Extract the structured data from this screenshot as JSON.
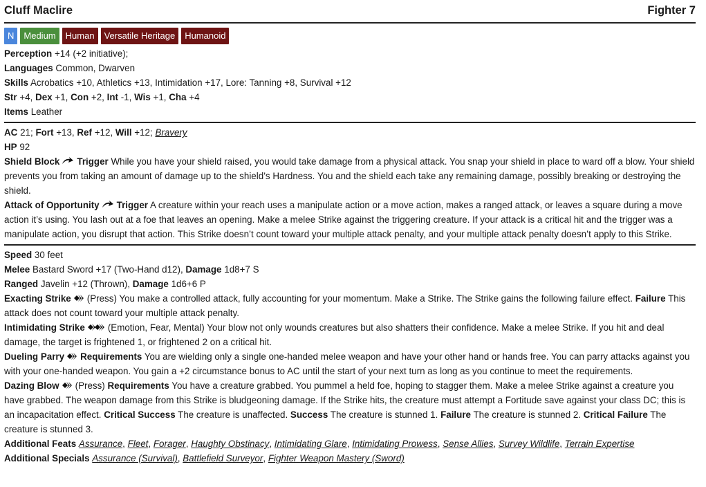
{
  "header": {
    "name": "Cluff Maclire",
    "class_level": "Fighter 7"
  },
  "traits": {
    "alignment": "N",
    "size": "Medium",
    "ancestry": [
      "Human",
      "Versatile Heritage",
      "Humanoid"
    ]
  },
  "colors": {
    "alignment": "#4a86dc",
    "size": "#4a8f3c",
    "ancestry": "#6e1414"
  },
  "perception": {
    "label": "Perception",
    "value": "+14 (+2 initiative);"
  },
  "languages": {
    "label": "Languages",
    "value": "Common, Dwarven"
  },
  "skills": {
    "label": "Skills",
    "value": "Acrobatics +10, Athletics +13, Intimidation +17, Lore: Tanning +8, Survival +12"
  },
  "attributes": [
    {
      "label": "Str",
      "value": "+4,"
    },
    {
      "label": "Dex",
      "value": "+1,"
    },
    {
      "label": "Con",
      "value": "+2,"
    },
    {
      "label": "Int",
      "value": "-1,"
    },
    {
      "label": "Wis",
      "value": "+1,"
    },
    {
      "label": "Cha",
      "value": "+4"
    }
  ],
  "items": {
    "label": "Items",
    "value": "Leather"
  },
  "defense": {
    "ac_label": "AC",
    "ac_value": "21;",
    "fort_label": "Fort",
    "fort_value": "+13,",
    "ref_label": "Ref",
    "ref_value": "+12,",
    "will_label": "Will",
    "will_value": "+12;",
    "will_link": "Bravery",
    "hp_label": "HP",
    "hp_value": "92"
  },
  "reactions": [
    {
      "name": "Shield Block",
      "trigger_label": "Trigger",
      "text": "While you have your shield raised, you would take damage from a physical attack. You snap your shield in place to ward off a blow. Your shield prevents you from taking an amount of damage up to the shield’s Hardness. You and the shield each take any remaining damage, possibly breaking or destroying the shield."
    },
    {
      "name": "Attack of Opportunity",
      "trigger_label": "Trigger",
      "text": "A creature within your reach uses a manipulate action or a move action, makes a ranged attack, or leaves a square during a move action it’s using. You lash out at a foe that leaves an opening. Make a melee Strike against the triggering creature. If your attack is a critical hit and the trigger was a manipulate action, you disrupt that action. This Strike doesn’t count toward your multiple attack penalty, and your multiple attack penalty doesn’t apply to this Strike."
    }
  ],
  "offense": {
    "speed_label": "Speed",
    "speed_value": "30 feet",
    "melee_label": "Melee",
    "melee_value": "Bastard Sword +17 (Two-Hand d12),",
    "melee_damage_label": "Damage",
    "melee_damage": "1d8+7 S",
    "ranged_label": "Ranged",
    "ranged_value": "Javelin +12 (Thrown),",
    "ranged_damage_label": "Damage",
    "ranged_damage": "1d6+6 P"
  },
  "actions": {
    "exacting": {
      "name": "Exacting Strike",
      "text": "(Press) You make a controlled attack, fully accounting for your momentum. Make a Strike. The Strike gains the following failure effect.",
      "failure_label": "Failure",
      "failure_text": "This attack does not count toward your multiple attack penalty."
    },
    "intimidating": {
      "name": "Intimidating Strike",
      "text": "(Emotion, Fear, Mental) Your blow not only wounds creatures but also shatters their confidence. Make a melee Strike. If you hit and deal damage, the target is frightened 1, or frightened 2 on a critical hit."
    },
    "dueling": {
      "name": "Dueling Parry",
      "req_label": "Requirements",
      "text": "You are wielding only a single one-handed melee weapon and have your other hand or hands free. You can parry attacks against you with your one-handed weapon. You gain a +2 circumstance bonus to AC until the start of your next turn as long as you continue to meet the requirements."
    },
    "dazing": {
      "name": "Dazing Blow",
      "press": "(Press)",
      "req_label": "Requirements",
      "text": "You have a creature grabbed. You pummel a held foe, hoping to stagger them. Make a melee Strike against a creature you have grabbed. The weapon damage from this Strike is bludgeoning damage. If the Strike hits, the creature must attempt a Fortitude save against your class DC; this is an incapacitation effect.",
      "crit_success_label": "Critical Success",
      "crit_success": "The creature is unaffected.",
      "success_label": "Success",
      "success": "The creature is stunned 1.",
      "failure_label": "Failure",
      "failure": "The creature is stunned 2.",
      "crit_failure_label": "Critical Failure",
      "crit_failure": "The creature is stunned 3."
    }
  },
  "additional_feats": {
    "label": "Additional Feats",
    "items": [
      "Assurance",
      "Fleet",
      "Forager",
      "Haughty Obstinacy",
      "Intimidating Glare",
      "Intimidating Prowess",
      "Sense Allies",
      "Survey Wildlife",
      "Terrain Expertise"
    ]
  },
  "additional_specials": {
    "label": "Additional Specials",
    "items": [
      "Assurance (Survival)",
      "Battlefield Surveyor",
      "Fighter Weapon Mastery (Sword)"
    ]
  }
}
